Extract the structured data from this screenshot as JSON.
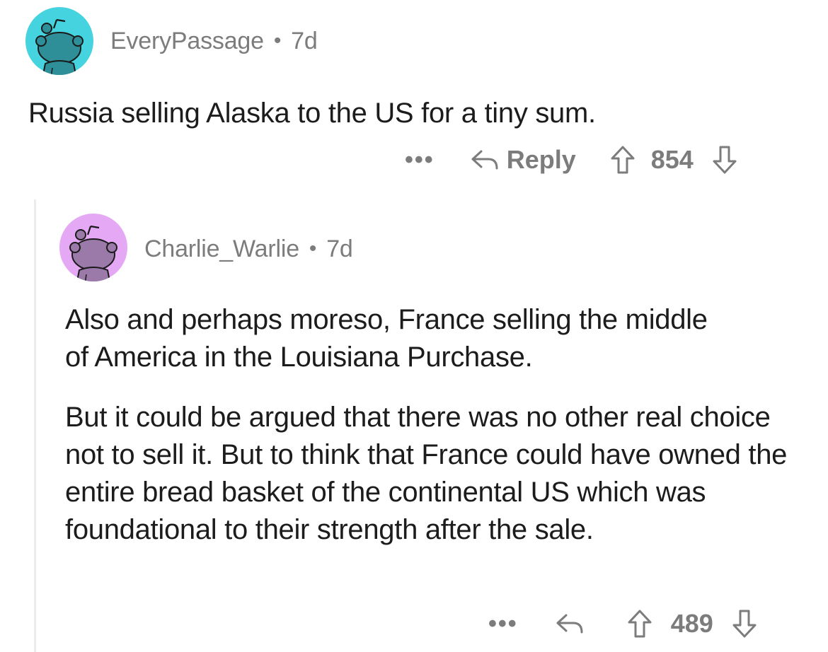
{
  "comments": [
    {
      "username": "EveryPassage",
      "separator": "•",
      "age": "7d",
      "avatar_color": "#46d3e0",
      "body": [
        "Russia selling Alaska to the US for a tiny sum."
      ],
      "more_label": "•••",
      "reply_icon": "reply-arrow-icon",
      "reply_label": "Reply",
      "upvote_icon": "upvote-arrow-icon",
      "score": "854",
      "downvote_icon": "downvote-arrow-icon"
    },
    {
      "username": "Charlie_Warlie",
      "separator": "•",
      "age": "7d",
      "avatar_color": "#e5a8f4",
      "body": [
        "Also and perhaps moreso, France selling the middle of America in the Louisiana Purchase.",
        "But it could be argued that there was no other real choice not to sell it. But to think that France could have owned the entire bread basket of the continental US which was foundational to their strength after the sale."
      ],
      "more_label": "•••",
      "reply_icon": "reply-arrow-icon",
      "upvote_icon": "upvote-arrow-icon",
      "score": "489",
      "downvote_icon": "downvote-arrow-icon"
    }
  ]
}
